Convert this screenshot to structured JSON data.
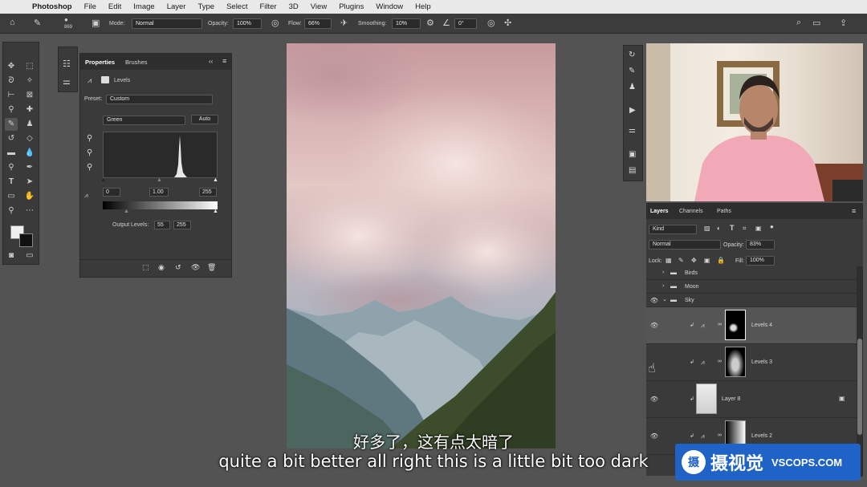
{
  "menubar": {
    "app": "Photoshop",
    "items": [
      "File",
      "Edit",
      "Image",
      "Layer",
      "Type",
      "Select",
      "Filter",
      "3D",
      "View",
      "Plugins",
      "Window",
      "Help"
    ]
  },
  "options": {
    "brush_size": "869",
    "mode_label": "Mode:",
    "mode_value": "Normal",
    "opacity_label": "Opacity:",
    "opacity_value": "100%",
    "flow_label": "Flow:",
    "flow_value": "66%",
    "smoothing_label": "Smoothing:",
    "smoothing_value": "10%",
    "angle_value": "0°"
  },
  "properties": {
    "tab_active": "Properties",
    "tab_other": "Brushes",
    "adjustment": "Levels",
    "preset_label": "Preset:",
    "preset_value": "Custom",
    "channel_value": "Green",
    "auto_label": "Auto",
    "input_black": "0",
    "input_mid": "1.00",
    "input_white": "255",
    "output_label": "Output Levels:",
    "output_black": "55",
    "output_white": "255"
  },
  "layers_panel": {
    "tabs": [
      "Layers",
      "Channels",
      "Paths"
    ],
    "filter_value": "Kind",
    "blend_value": "Normal",
    "opacity_label": "Opacity:",
    "opacity_value": "83%",
    "lock_label": "Lock:",
    "fill_label": "Fill:",
    "fill_value": "100%",
    "rows": [
      {
        "name": "Birds"
      },
      {
        "name": "Moon"
      },
      {
        "name": "Sky"
      },
      {
        "name": "Levels 4"
      },
      {
        "name": "Levels 3"
      },
      {
        "name": "Layer 8"
      },
      {
        "name": "Levels 2"
      }
    ]
  },
  "subtitles": {
    "cn": "好多了，这有点太暗了",
    "en": "quite a bit better all right this is a little bit too dark"
  },
  "watermark": {
    "cn": "摄视觉",
    "en": "VSCOPS.COM",
    "badge": "摄"
  }
}
